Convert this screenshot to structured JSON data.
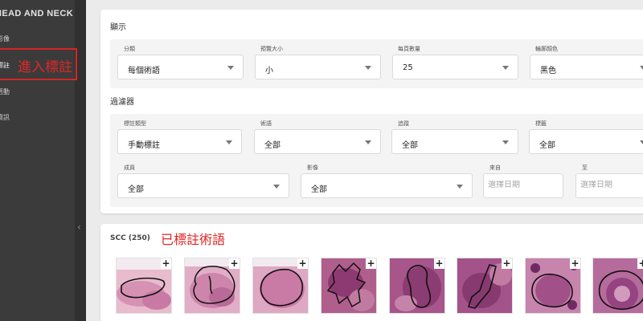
{
  "sidebar": {
    "title": "HEAD AND NECK",
    "items": [
      {
        "label": "影像"
      },
      {
        "label": "標註"
      },
      {
        "label": "活動"
      },
      {
        "label": "資訊"
      }
    ],
    "callout": "進入標註",
    "collapse_icon": "chevron-left-icon"
  },
  "display": {
    "title": "顯示",
    "fields": [
      {
        "label": "分類",
        "value": "每個術語"
      },
      {
        "label": "預覽大小",
        "value": "小"
      },
      {
        "label": "每頁數量",
        "value": "25"
      },
      {
        "label": "輪廓顏色",
        "value": "黑色"
      }
    ]
  },
  "filter": {
    "title": "過濾器",
    "row1": [
      {
        "label": "標註類型",
        "value": "手動標註"
      },
      {
        "label": "術語",
        "value": "全部"
      },
      {
        "label": "追蹤",
        "value": "全部"
      },
      {
        "label": "標籤",
        "value": "全部"
      }
    ],
    "row2": [
      {
        "label": "成員",
        "value": "全部"
      },
      {
        "label": "影像",
        "value": "全部"
      }
    ],
    "from": {
      "label": "來自",
      "placeholder": "選擇日期"
    },
    "to": {
      "label": "至",
      "placeholder": "選擇日期"
    }
  },
  "results": {
    "term_title": "SCC (250)",
    "annotated_label": "已標註術語",
    "add_label": "+",
    "thumbnails": [
      {
        "name": "annotation-1"
      },
      {
        "name": "annotation-2"
      },
      {
        "name": "annotation-3"
      },
      {
        "name": "annotation-4"
      },
      {
        "name": "annotation-5"
      },
      {
        "name": "annotation-6"
      },
      {
        "name": "annotation-7"
      },
      {
        "name": "annotation-8"
      }
    ]
  },
  "colors": {
    "sidebar_bg": "#3b3b3b",
    "accent_red": "#e12626",
    "tissue_light": "#e3b7c9",
    "tissue_dark": "#a54a83"
  }
}
